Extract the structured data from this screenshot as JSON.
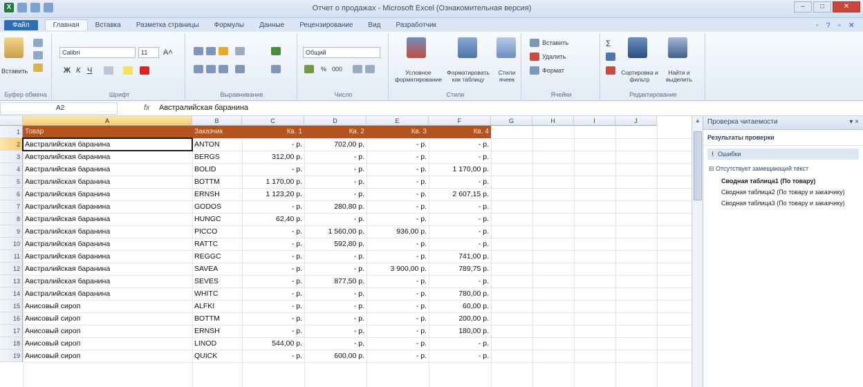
{
  "window": {
    "title": "Отчет о продажах - Microsoft Excel (Ознакомительная версия)",
    "app_logo": "X",
    "controls": [
      "–",
      "□",
      "✕"
    ]
  },
  "ribbon_tabs": {
    "file": "Файл",
    "items": [
      "Главная",
      "Вставка",
      "Разметка страницы",
      "Формулы",
      "Данные",
      "Рецензирование",
      "Вид",
      "Разработчик"
    ]
  },
  "ribbon": {
    "clipboard": {
      "paste": "Вставить",
      "label": "Буфер обмена"
    },
    "font": {
      "name": "Calibri",
      "size": "11",
      "grow": "A˄",
      "shrink": "A˅",
      "bold": "Ж",
      "italic": "К",
      "underline": "Ч",
      "label": "Шрифт"
    },
    "alignment": {
      "label": "Выравнивание"
    },
    "number": {
      "format": "Общий",
      "percent": "%",
      "thousands": "000",
      "label": "Число"
    },
    "styles": {
      "conditional": "Условное форматирование",
      "as_table": "Форматировать как таблицу",
      "cell_styles": "Стили ячеек",
      "label": "Стили"
    },
    "cells": {
      "insert": "Вставить",
      "delete": "Удалить",
      "format": "Формат",
      "label": "Ячейки"
    },
    "editing": {
      "sort": "Сортировка и фильтр",
      "find": "Найти и выделить",
      "label": "Редактирование"
    }
  },
  "formula_bar": {
    "name_box": "A2",
    "fx": "fx",
    "content": "Австралийская баранина"
  },
  "columns": [
    "A",
    "B",
    "C",
    "D",
    "E",
    "F",
    "G",
    "H",
    "I",
    "J"
  ],
  "table": {
    "headers": [
      "Товар",
      "Заказчик",
      "Кв. 1",
      "Кв. 2",
      "Кв. 3",
      "Кв. 4"
    ],
    "rows": [
      [
        "Австралийская баранина",
        "ANTON",
        "-   р.",
        "702,00 р.",
        "-   р.",
        "-   р."
      ],
      [
        "Австралийская баранина",
        "BERGS",
        "312,00 р.",
        "-   р.",
        "-   р.",
        "-   р."
      ],
      [
        "Австралийская баранина",
        "BOLID",
        "-   р.",
        "-   р.",
        "-   р.",
        "1 170,00 р."
      ],
      [
        "Австралийская баранина",
        "BOTTM",
        "1 170,00 р.",
        "-   р.",
        "-   р.",
        "-   р."
      ],
      [
        "Австралийская баранина",
        "ERNSH",
        "1 123,20 р.",
        "-   р.",
        "-   р.",
        "2 607,15 р."
      ],
      [
        "Австралийская баранина",
        "GODOS",
        "-   р.",
        "280,80 р.",
        "-   р.",
        "-   р."
      ],
      [
        "Австралийская баранина",
        "HUNGC",
        "62,40 р.",
        "-   р.",
        "-   р.",
        "-   р."
      ],
      [
        "Австралийская баранина",
        "PICCO",
        "-   р.",
        "1 560,00 р.",
        "936,00 р.",
        "-   р."
      ],
      [
        "Австралийская баранина",
        "RATTC",
        "-   р.",
        "592,80 р.",
        "-   р.",
        "-   р."
      ],
      [
        "Австралийская баранина",
        "REGGC",
        "-   р.",
        "-   р.",
        "-   р.",
        "741,00 р."
      ],
      [
        "Австралийская баранина",
        "SAVEA",
        "-   р.",
        "-   р.",
        "3 900,00 р.",
        "789,75 р."
      ],
      [
        "Австралийская баранина",
        "SEVES",
        "-   р.",
        "877,50 р.",
        "-   р.",
        "-   р."
      ],
      [
        "Австралийская баранина",
        "WHITC",
        "-   р.",
        "-   р.",
        "-   р.",
        "780,00 р."
      ],
      [
        "Анисовый сироп",
        "ALFKI",
        "-   р.",
        "-   р.",
        "-   р.",
        "60,00 р."
      ],
      [
        "Анисовый сироп",
        "BOTTM",
        "-   р.",
        "-   р.",
        "-   р.",
        "200,00 р."
      ],
      [
        "Анисовый сироп",
        "ERNSH",
        "-   р.",
        "-   р.",
        "-   р.",
        "180,00 р."
      ],
      [
        "Анисовый сироп",
        "LINOD",
        "544,00 р.",
        "-   р.",
        "-   р.",
        "-   р."
      ],
      [
        "Анисовый сироп",
        "QUICK",
        "-   р.",
        "600,00 р.",
        "-   р.",
        "-   р."
      ]
    ]
  },
  "row_numbers": [
    "1",
    "2",
    "3",
    "4",
    "5",
    "6",
    "7",
    "8",
    "9",
    "10",
    "11",
    "12",
    "13",
    "14",
    "15",
    "16",
    "17",
    "18",
    "19"
  ],
  "task_pane": {
    "title": "Проверка читаемости",
    "close": "▾ ×",
    "results_heading": "Результаты проверки",
    "errors_label": "Ошибки",
    "group": "Отсутствует замещающий текст",
    "items": [
      "Сводная таблица1 (По товару)",
      "Сводная таблица2 (По товару и заказчику)",
      "Сводная таблица3 (По товару и заказчику)"
    ]
  },
  "colors": {
    "header_fill": "#b3541e",
    "selection": "#f5cc6f",
    "file_tab": "#2c6fb7"
  }
}
